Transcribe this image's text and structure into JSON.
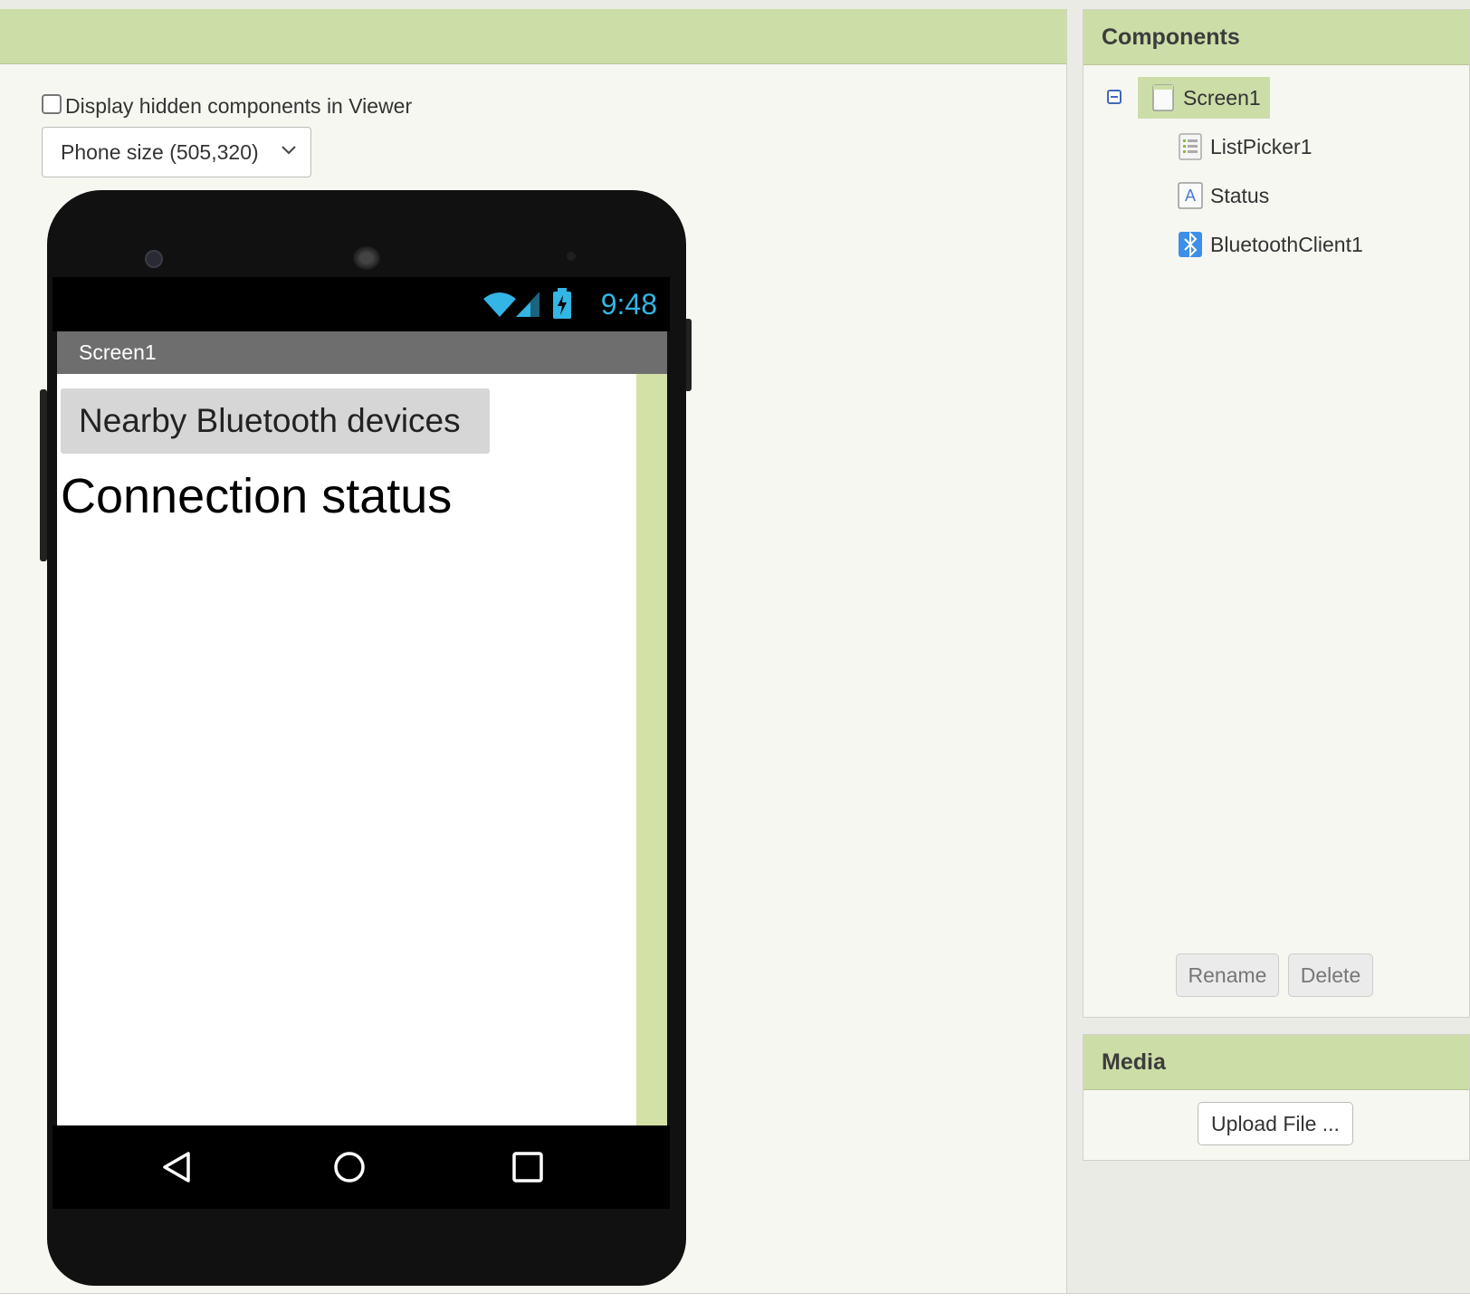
{
  "viewer": {
    "hidden_checkbox_label": "Display hidden components in Viewer",
    "phone_size_selected": "Phone size (505,320)"
  },
  "phone": {
    "status_time": "9:48",
    "screen_title": "Screen1",
    "nearby_button_text": "Nearby Bluetooth devices",
    "status_label_text": "Connection status"
  },
  "components": {
    "header": "Components",
    "tree": [
      {
        "label": "Screen1",
        "icon": "screen-icon",
        "selected": true
      },
      {
        "label": "ListPicker1",
        "icon": "listpicker-icon"
      },
      {
        "label": "Status",
        "icon": "label-icon"
      },
      {
        "label": "BluetoothClient1",
        "icon": "bluetooth-icon"
      }
    ],
    "rename_label": "Rename",
    "delete_label": "Delete"
  },
  "media": {
    "header": "Media",
    "upload_label": "Upload File ..."
  },
  "colors": {
    "header_green": "#cddda8",
    "status_blue": "#33b5e5"
  }
}
